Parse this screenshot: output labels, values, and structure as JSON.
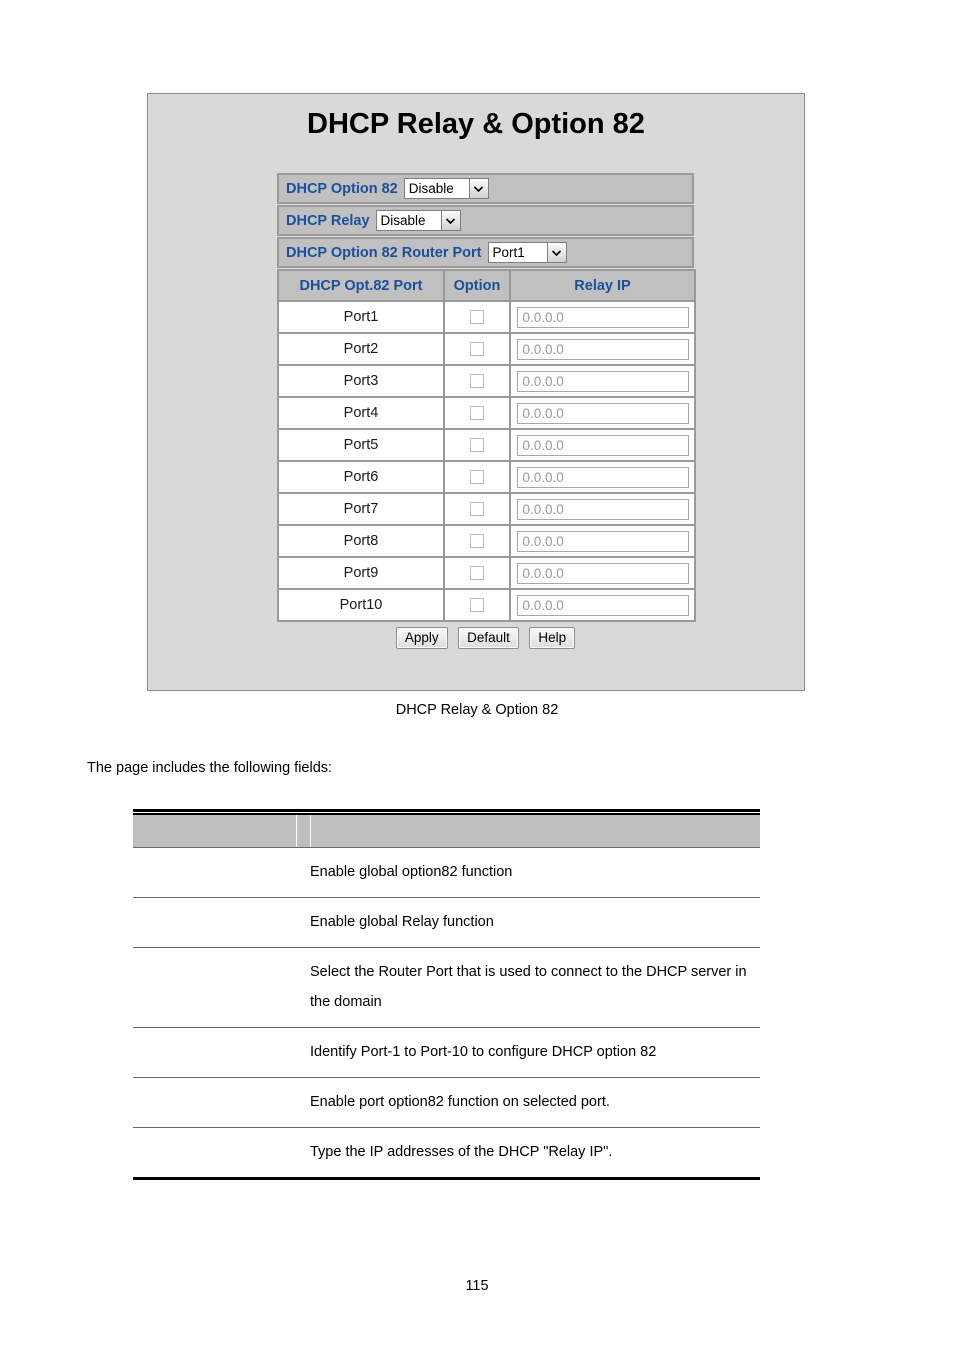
{
  "document": {
    "page_number": "115",
    "intro_text": "The page includes the following fields:",
    "figure_caption": "DHCP Relay & Option 82"
  },
  "screenshot": {
    "title": "DHCP Relay & Option 82",
    "settings": [
      {
        "label": "DHCP Option 82",
        "value": "Disable"
      },
      {
        "label": "DHCP Relay",
        "value": "Disable"
      },
      {
        "label": "DHCP Option 82 Router Port",
        "value": "Port1"
      }
    ],
    "port_table": {
      "headers": [
        "DHCP Opt.82 Port",
        "Option",
        "Relay IP"
      ],
      "rows": [
        {
          "port": "Port1",
          "option_checked": false,
          "relay_ip": "0.0.0.0"
        },
        {
          "port": "Port2",
          "option_checked": false,
          "relay_ip": "0.0.0.0"
        },
        {
          "port": "Port3",
          "option_checked": false,
          "relay_ip": "0.0.0.0"
        },
        {
          "port": "Port4",
          "option_checked": false,
          "relay_ip": "0.0.0.0"
        },
        {
          "port": "Port5",
          "option_checked": false,
          "relay_ip": "0.0.0.0"
        },
        {
          "port": "Port6",
          "option_checked": false,
          "relay_ip": "0.0.0.0"
        },
        {
          "port": "Port7",
          "option_checked": false,
          "relay_ip": "0.0.0.0"
        },
        {
          "port": "Port8",
          "option_checked": false,
          "relay_ip": "0.0.0.0"
        },
        {
          "port": "Port9",
          "option_checked": false,
          "relay_ip": "0.0.0.0"
        },
        {
          "port": "Port10",
          "option_checked": false,
          "relay_ip": "0.0.0.0"
        }
      ]
    },
    "buttons": {
      "apply": "Apply",
      "default": "Default",
      "help": "Help"
    },
    "colors": {
      "panel_background": "#d9d9d9",
      "row_background": "#c0c0c0",
      "label_text": "#1b4f9c",
      "placeholder_text": "#9b9b9b"
    }
  },
  "description_table": {
    "header": {
      "col1": "",
      "col2": "",
      "col3": ""
    },
    "rows": [
      {
        "object": "",
        "description": "Enable global option82 function"
      },
      {
        "object": "",
        "description": "Enable global Relay function"
      },
      {
        "object": "",
        "description": "Select the Router Port that is used to connect to the DHCP server in the domain"
      },
      {
        "object": "",
        "description": "Identify Port-1 to Port-10 to configure DHCP option 82"
      },
      {
        "object": "",
        "description": "Enable port option82 function on selected port."
      },
      {
        "object": "",
        "description": "Type the IP addresses of the DHCP \"Relay IP\"."
      }
    ]
  }
}
